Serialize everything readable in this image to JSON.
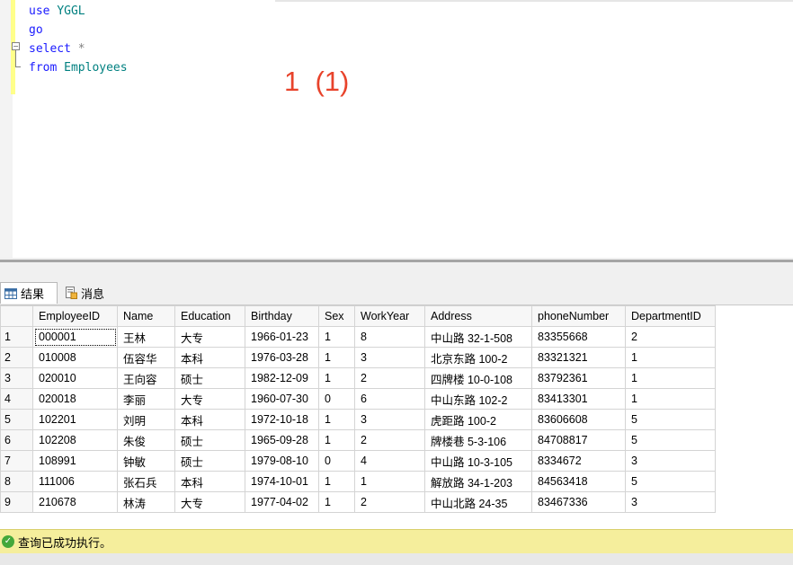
{
  "editor": {
    "lines": [
      {
        "kw": "use",
        "rest": " ",
        "id": "YGGL"
      },
      {
        "kw": "go"
      },
      {
        "kw": "select",
        "rest": " ",
        "op": "*"
      },
      {
        "kw": "from",
        "rest": " ",
        "id": "Employees"
      }
    ],
    "annotation": "1  (1)"
  },
  "tabs": [
    {
      "label": "结果",
      "icon": "grid-icon"
    },
    {
      "label": "消息",
      "icon": "messages-icon"
    }
  ],
  "grid": {
    "columns": [
      "EmployeeID",
      "Name",
      "Education",
      "Birthday",
      "Sex",
      "WorkYear",
      "Address",
      "phoneNumber",
      "DepartmentID"
    ],
    "rows": [
      [
        "1",
        "000001",
        "王林",
        "大专",
        "1966-01-23",
        "1",
        "8",
        "中山路 32-1-508",
        "83355668",
        "2"
      ],
      [
        "2",
        "010008",
        "伍容华",
        "本科",
        "1976-03-28",
        "1",
        "3",
        "北京东路 100-2",
        "83321321",
        "1"
      ],
      [
        "3",
        "020010",
        "王向容",
        "硕士",
        "1982-12-09",
        "1",
        "2",
        "四牌楼 10-0-108",
        "83792361",
        "1"
      ],
      [
        "4",
        "020018",
        "李丽",
        "大专",
        "1960-07-30",
        "0",
        "6",
        "中山东路 102-2",
        "83413301",
        "1"
      ],
      [
        "5",
        "102201",
        "刘明",
        "本科",
        "1972-10-18",
        "1",
        "3",
        "虎距路 100-2",
        "83606608",
        "5"
      ],
      [
        "6",
        "102208",
        "朱俊",
        "硕士",
        "1965-09-28",
        "1",
        "2",
        "牌楼巷 5-3-106",
        "84708817",
        "5"
      ],
      [
        "7",
        "108991",
        "钟敏",
        "硕士",
        "1979-08-10",
        "0",
        "4",
        "中山路 10-3-105",
        "8334672",
        "3"
      ],
      [
        "8",
        "111006",
        "张石兵",
        "本科",
        "1974-10-01",
        "1",
        "1",
        "解放路 34-1-203",
        "84563418",
        "5"
      ],
      [
        "9",
        "210678",
        "林涛",
        "大专",
        "1977-04-02",
        "1",
        "2",
        "中山北路 24-35",
        "83467336",
        "3"
      ]
    ]
  },
  "status": {
    "text": "查询已成功执行。",
    "icon": "success-check-icon",
    "color": "#f5ee9c"
  }
}
